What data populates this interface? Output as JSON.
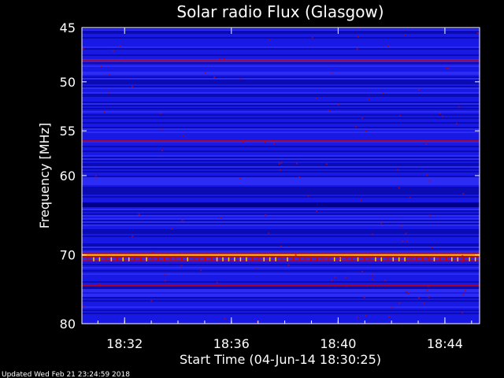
{
  "chart_data": {
    "type": "heatmap",
    "title": "Solar radio Flux (Glasgow)",
    "xlabel": "Start Time (04-Jun-14 18:30:25)",
    "ylabel_text": "Frequency ",
    "ylabel_unit": "[MHz]",
    "y_scale": "log",
    "ylim": [
      45,
      80
    ],
    "y_ticks": [
      45,
      50,
      55,
      60,
      70,
      80
    ],
    "x_start_minutes": 0.4,
    "x_end_minutes": 15.3,
    "x_ticks": [
      {
        "value": 2,
        "label": "18:32"
      },
      {
        "value": 6,
        "label": "18:36"
      },
      {
        "value": 10,
        "label": "18:40"
      },
      {
        "value": 14,
        "label": "18:44"
      }
    ],
    "colormap": [
      "#00008a",
      "#1a1ae6",
      "#3c3cff",
      "#cc0000",
      "#ffd000",
      "#ffffff"
    ],
    "intense_bands_mhz": [
      {
        "freq": 48.0,
        "level": "medium"
      },
      {
        "freq": 56.1,
        "level": "medium"
      },
      {
        "freq": 63.5,
        "level": "dark"
      },
      {
        "freq": 70.0,
        "level": "high"
      },
      {
        "freq": 70.8,
        "level": "medium"
      },
      {
        "freq": 74.3,
        "level": "medium"
      }
    ],
    "grid": false,
    "legend": "none"
  },
  "footer": {
    "updated": "Updated Wed Feb 21 23:24:59 2018"
  }
}
